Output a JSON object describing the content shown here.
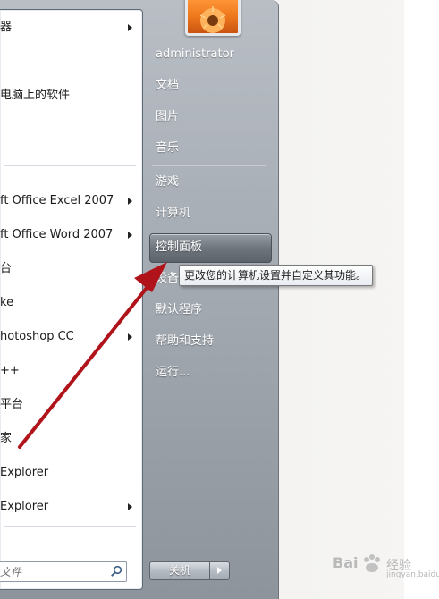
{
  "left_menu": {
    "items": [
      {
        "label": "器",
        "arrow": true
      },
      {
        "label": "电脑上的软件",
        "arrow": false
      },
      {
        "label": "ft Office Excel 2007",
        "arrow": true
      },
      {
        "label": "ft Office Word 2007",
        "arrow": true
      },
      {
        "label": "台",
        "arrow": false
      },
      {
        "label": "ke",
        "arrow": false
      },
      {
        "label": "hotoshop CC",
        "arrow": true
      },
      {
        "label": "++",
        "arrow": false
      },
      {
        "label": "平台",
        "arrow": false
      },
      {
        "label": "家",
        "arrow": false
      },
      {
        "label": "Explorer",
        "arrow": false
      },
      {
        "label": "Explorer",
        "arrow": true
      }
    ],
    "search_placeholder": "文件"
  },
  "right_menu": {
    "user": "administrator",
    "items": [
      "文档",
      "图片",
      "音乐",
      "游戏",
      "计算机",
      "控制面板",
      "设备",
      "默认程序",
      "帮助和支持",
      "运行..."
    ],
    "highlighted": "控制面板"
  },
  "tooltip": "更改您的计算机设置并自定义其功能。",
  "shutdown": {
    "label": "关机"
  },
  "watermark": {
    "brand": "Bai",
    "text": "经验",
    "sub": "jingyan.baidu.com"
  },
  "colors": {
    "annotation_arrow": "#b0141a"
  }
}
